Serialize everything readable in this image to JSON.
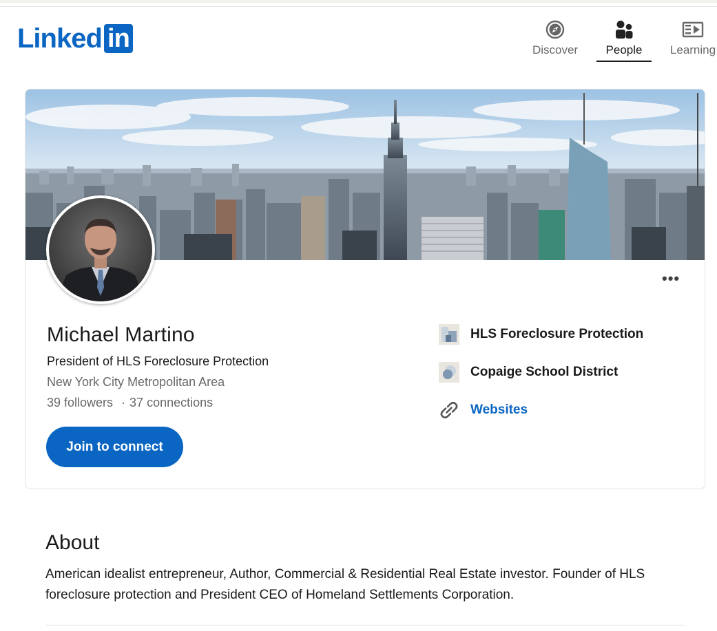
{
  "brand": {
    "logo_word": "Linked",
    "logo_box": "in",
    "color": "#0a66c2"
  },
  "nav": {
    "items": [
      {
        "label": "Discover",
        "icon": "compass-icon",
        "active": false
      },
      {
        "label": "People",
        "icon": "people-icon",
        "active": true
      },
      {
        "label": "Learning",
        "icon": "video-play-icon",
        "active": false
      }
    ]
  },
  "profile": {
    "name": "Michael Martino",
    "headline": "President of HLS Foreclosure Protection",
    "location": "New York City Metropolitan Area",
    "followers": "39 followers",
    "separator": "·",
    "connections": "37 connections",
    "join_label": "Join to connect",
    "more_label": "•••",
    "banner": "city-skyline-photo",
    "avatar": "profile-photo"
  },
  "side": {
    "company": "HLS Foreclosure Protection",
    "education": "Copaige School District",
    "websites_label": "Websites",
    "link_color": "#0a66c2"
  },
  "about": {
    "title": "About",
    "text": "American idealist entrepreneur, Author, Commercial & Residential Real Estate investor. Founder of HLS foreclosure protection and President CEO of Homeland Settlements Corporation."
  }
}
